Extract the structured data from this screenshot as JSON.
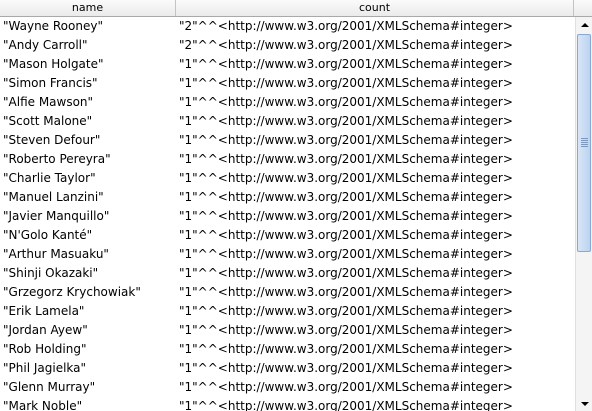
{
  "columns": {
    "name": "name",
    "count": "count"
  },
  "rows": [
    {
      "name": "\"Wayne Rooney\"",
      "count": "\"2\"^^<http://www.w3.org/2001/XMLSchema#integer>"
    },
    {
      "name": "\"Andy Carroll\"",
      "count": "\"2\"^^<http://www.w3.org/2001/XMLSchema#integer>"
    },
    {
      "name": "\"Mason Holgate\"",
      "count": "\"1\"^^<http://www.w3.org/2001/XMLSchema#integer>"
    },
    {
      "name": "\"Simon Francis\"",
      "count": "\"1\"^^<http://www.w3.org/2001/XMLSchema#integer>"
    },
    {
      "name": "\"Alfie Mawson\"",
      "count": "\"1\"^^<http://www.w3.org/2001/XMLSchema#integer>"
    },
    {
      "name": "\"Scott Malone\"",
      "count": "\"1\"^^<http://www.w3.org/2001/XMLSchema#integer>"
    },
    {
      "name": "\"Steven Defour\"",
      "count": "\"1\"^^<http://www.w3.org/2001/XMLSchema#integer>"
    },
    {
      "name": "\"Roberto Pereyra\"",
      "count": "\"1\"^^<http://www.w3.org/2001/XMLSchema#integer>"
    },
    {
      "name": "\"Charlie Taylor\"",
      "count": "\"1\"^^<http://www.w3.org/2001/XMLSchema#integer>"
    },
    {
      "name": "\"Manuel Lanzini\"",
      "count": "\"1\"^^<http://www.w3.org/2001/XMLSchema#integer>"
    },
    {
      "name": "\"Javier Manquillo\"",
      "count": "\"1\"^^<http://www.w3.org/2001/XMLSchema#integer>"
    },
    {
      "name": "\"N'Golo Kanté\"",
      "count": "\"1\"^^<http://www.w3.org/2001/XMLSchema#integer>"
    },
    {
      "name": "\"Arthur Masuaku\"",
      "count": "\"1\"^^<http://www.w3.org/2001/XMLSchema#integer>"
    },
    {
      "name": "\"Shinji Okazaki\"",
      "count": "\"1\"^^<http://www.w3.org/2001/XMLSchema#integer>"
    },
    {
      "name": "\"Grzegorz Krychowiak\"",
      "count": "\"1\"^^<http://www.w3.org/2001/XMLSchema#integer>"
    },
    {
      "name": "\"Erik Lamela\"",
      "count": "\"1\"^^<http://www.w3.org/2001/XMLSchema#integer>"
    },
    {
      "name": "\"Jordan Ayew\"",
      "count": "\"1\"^^<http://www.w3.org/2001/XMLSchema#integer>"
    },
    {
      "name": "\"Rob Holding\"",
      "count": "\"1\"^^<http://www.w3.org/2001/XMLSchema#integer>"
    },
    {
      "name": "\"Phil Jagielka\"",
      "count": "\"1\"^^<http://www.w3.org/2001/XMLSchema#integer>"
    },
    {
      "name": "\"Glenn Murray\"",
      "count": "\"1\"^^<http://www.w3.org/2001/XMLSchema#integer>"
    },
    {
      "name": "\"Mark Noble\"",
      "count": "\"1\"^^<http://www.w3.org/2001/XMLSchema#integer>"
    }
  ],
  "scrollbar": {
    "position_fraction": 0.0,
    "visible_fraction": 0.6
  },
  "colors": {
    "header_border": "#a9a9a9",
    "scroll_thumb": "#bcd3f0",
    "scroll_track": "#f4f4f4"
  },
  "icons": {
    "scroll_up": "arrow-up-icon",
    "scroll_down": "arrow-down-icon",
    "thumb_grip": "grip-icon"
  }
}
